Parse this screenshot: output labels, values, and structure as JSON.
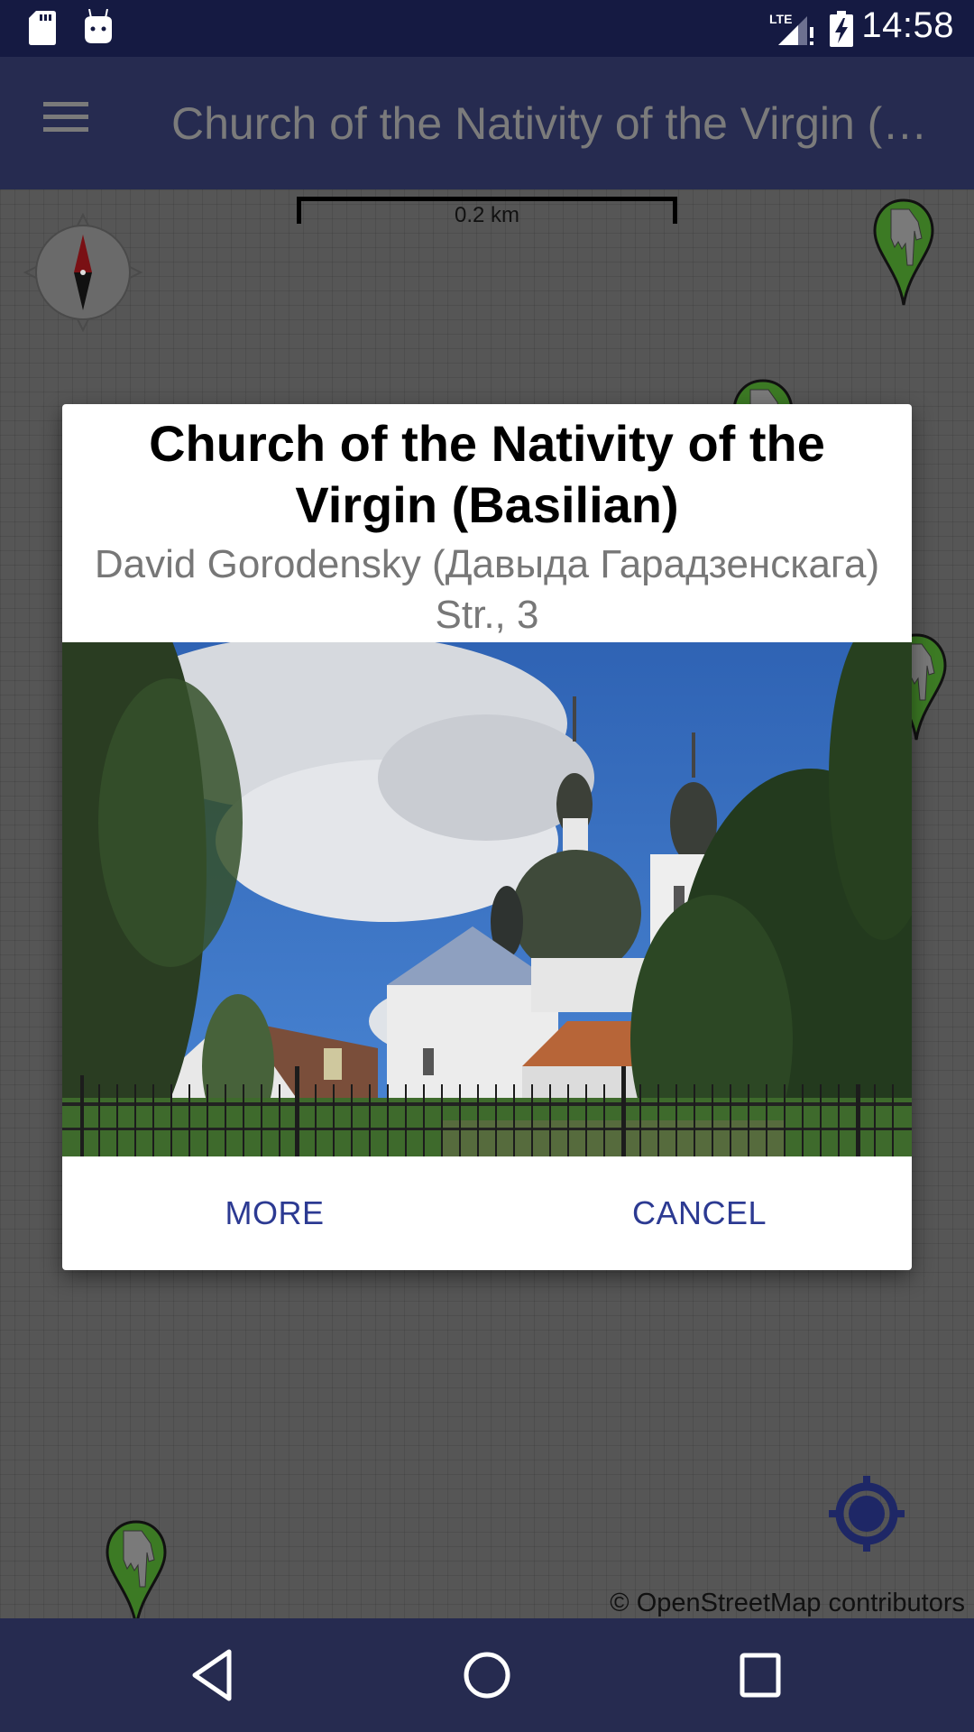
{
  "status_bar": {
    "time": "14:58",
    "left_icons": [
      "sd-card-icon",
      "android-debug-icon"
    ],
    "right_icons": [
      "lte-signal-icon",
      "battery-charging-icon"
    ],
    "network_label": "LTE"
  },
  "app_bar": {
    "menu_icon": "hamburger-menu-icon",
    "title": "Church of the Nativity of the Virgin (Basilian)"
  },
  "map": {
    "scale_label": "0.2 km",
    "attribution": "© OpenStreetMap contributors",
    "compass_icon": "compass-icon",
    "location_icon": "my-location-icon",
    "marker_icon": "pointing-hand-marker-icon",
    "marker_color": "#3c7a24"
  },
  "dialog": {
    "title": "Church of the Nativity of the Virgin (Basilian)",
    "address": "David Gorodensky (Давыда Гарадзенскага) Str., 3",
    "photo_alt": "Church with domes behind trees and fence",
    "more_label": "MORE",
    "cancel_label": "CANCEL",
    "accent_color": "#2c3a92"
  },
  "nav_bar": {
    "back_icon": "back-icon",
    "home_icon": "home-icon",
    "recents_icon": "recents-icon"
  }
}
